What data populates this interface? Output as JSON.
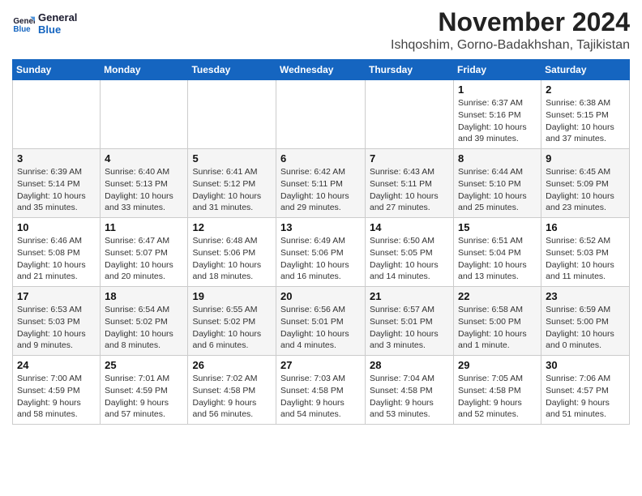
{
  "header": {
    "logo_line1": "General",
    "logo_line2": "Blue",
    "month": "November 2024",
    "location": "Ishqoshim, Gorno-Badakhshan, Tajikistan"
  },
  "days_of_week": [
    "Sunday",
    "Monday",
    "Tuesday",
    "Wednesday",
    "Thursday",
    "Friday",
    "Saturday"
  ],
  "weeks": [
    [
      {
        "day": "",
        "info": ""
      },
      {
        "day": "",
        "info": ""
      },
      {
        "day": "",
        "info": ""
      },
      {
        "day": "",
        "info": ""
      },
      {
        "day": "",
        "info": ""
      },
      {
        "day": "1",
        "info": "Sunrise: 6:37 AM\nSunset: 5:16 PM\nDaylight: 10 hours\nand 39 minutes."
      },
      {
        "day": "2",
        "info": "Sunrise: 6:38 AM\nSunset: 5:15 PM\nDaylight: 10 hours\nand 37 minutes."
      }
    ],
    [
      {
        "day": "3",
        "info": "Sunrise: 6:39 AM\nSunset: 5:14 PM\nDaylight: 10 hours\nand 35 minutes."
      },
      {
        "day": "4",
        "info": "Sunrise: 6:40 AM\nSunset: 5:13 PM\nDaylight: 10 hours\nand 33 minutes."
      },
      {
        "day": "5",
        "info": "Sunrise: 6:41 AM\nSunset: 5:12 PM\nDaylight: 10 hours\nand 31 minutes."
      },
      {
        "day": "6",
        "info": "Sunrise: 6:42 AM\nSunset: 5:11 PM\nDaylight: 10 hours\nand 29 minutes."
      },
      {
        "day": "7",
        "info": "Sunrise: 6:43 AM\nSunset: 5:11 PM\nDaylight: 10 hours\nand 27 minutes."
      },
      {
        "day": "8",
        "info": "Sunrise: 6:44 AM\nSunset: 5:10 PM\nDaylight: 10 hours\nand 25 minutes."
      },
      {
        "day": "9",
        "info": "Sunrise: 6:45 AM\nSunset: 5:09 PM\nDaylight: 10 hours\nand 23 minutes."
      }
    ],
    [
      {
        "day": "10",
        "info": "Sunrise: 6:46 AM\nSunset: 5:08 PM\nDaylight: 10 hours\nand 21 minutes."
      },
      {
        "day": "11",
        "info": "Sunrise: 6:47 AM\nSunset: 5:07 PM\nDaylight: 10 hours\nand 20 minutes."
      },
      {
        "day": "12",
        "info": "Sunrise: 6:48 AM\nSunset: 5:06 PM\nDaylight: 10 hours\nand 18 minutes."
      },
      {
        "day": "13",
        "info": "Sunrise: 6:49 AM\nSunset: 5:06 PM\nDaylight: 10 hours\nand 16 minutes."
      },
      {
        "day": "14",
        "info": "Sunrise: 6:50 AM\nSunset: 5:05 PM\nDaylight: 10 hours\nand 14 minutes."
      },
      {
        "day": "15",
        "info": "Sunrise: 6:51 AM\nSunset: 5:04 PM\nDaylight: 10 hours\nand 13 minutes."
      },
      {
        "day": "16",
        "info": "Sunrise: 6:52 AM\nSunset: 5:03 PM\nDaylight: 10 hours\nand 11 minutes."
      }
    ],
    [
      {
        "day": "17",
        "info": "Sunrise: 6:53 AM\nSunset: 5:03 PM\nDaylight: 10 hours\nand 9 minutes."
      },
      {
        "day": "18",
        "info": "Sunrise: 6:54 AM\nSunset: 5:02 PM\nDaylight: 10 hours\nand 8 minutes."
      },
      {
        "day": "19",
        "info": "Sunrise: 6:55 AM\nSunset: 5:02 PM\nDaylight: 10 hours\nand 6 minutes."
      },
      {
        "day": "20",
        "info": "Sunrise: 6:56 AM\nSunset: 5:01 PM\nDaylight: 10 hours\nand 4 minutes."
      },
      {
        "day": "21",
        "info": "Sunrise: 6:57 AM\nSunset: 5:01 PM\nDaylight: 10 hours\nand 3 minutes."
      },
      {
        "day": "22",
        "info": "Sunrise: 6:58 AM\nSunset: 5:00 PM\nDaylight: 10 hours\nand 1 minute."
      },
      {
        "day": "23",
        "info": "Sunrise: 6:59 AM\nSunset: 5:00 PM\nDaylight: 10 hours\nand 0 minutes."
      }
    ],
    [
      {
        "day": "24",
        "info": "Sunrise: 7:00 AM\nSunset: 4:59 PM\nDaylight: 9 hours\nand 58 minutes."
      },
      {
        "day": "25",
        "info": "Sunrise: 7:01 AM\nSunset: 4:59 PM\nDaylight: 9 hours\nand 57 minutes."
      },
      {
        "day": "26",
        "info": "Sunrise: 7:02 AM\nSunset: 4:58 PM\nDaylight: 9 hours\nand 56 minutes."
      },
      {
        "day": "27",
        "info": "Sunrise: 7:03 AM\nSunset: 4:58 PM\nDaylight: 9 hours\nand 54 minutes."
      },
      {
        "day": "28",
        "info": "Sunrise: 7:04 AM\nSunset: 4:58 PM\nDaylight: 9 hours\nand 53 minutes."
      },
      {
        "day": "29",
        "info": "Sunrise: 7:05 AM\nSunset: 4:58 PM\nDaylight: 9 hours\nand 52 minutes."
      },
      {
        "day": "30",
        "info": "Sunrise: 7:06 AM\nSunset: 4:57 PM\nDaylight: 9 hours\nand 51 minutes."
      }
    ]
  ]
}
